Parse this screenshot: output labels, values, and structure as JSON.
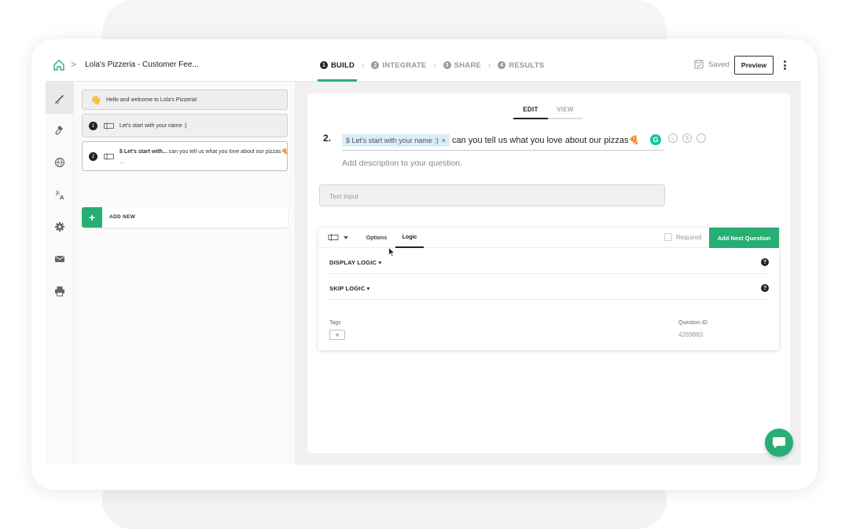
{
  "header": {
    "breadcrumb_sep": ">",
    "project_title": "Lola's Pizzeria - Customer Fee...",
    "steps": [
      {
        "num": "1",
        "label": "BUILD"
      },
      {
        "num": "2",
        "label": "INTEGRATE"
      },
      {
        "num": "3",
        "label": "SHARE"
      },
      {
        "num": "4",
        "label": "RESULTS"
      }
    ],
    "saved_label": "Saved",
    "preview_label": "Preview"
  },
  "left_nav": [
    "brush-icon",
    "paint-roller-icon",
    "globe-icon",
    "translate-icon",
    "gear-icon",
    "mail-icon",
    "printer-icon"
  ],
  "questions": {
    "welcome": {
      "emoji": "👋",
      "text": "Hello and welcome to Lola's Pizzeria!"
    },
    "items": [
      {
        "num": "1",
        "text": "Let's start with your name :)"
      },
      {
        "num": "2",
        "text_bold": "$ Let's start with...",
        "text": " can you tell us what you love about our pizzas🍕",
        "more": "..."
      }
    ],
    "add_new_label": "ADD NEW"
  },
  "editor": {
    "tabs": [
      "EDIT",
      "VIEW"
    ],
    "question_number": "2.",
    "pipe_chip": "$ Let's start with your name :)",
    "pipe_chip_close": "×",
    "question_text": "can you tell us what you love about our pizzas🍕",
    "grammarly": "G",
    "description_placeholder": "Add description to your question.",
    "input_placeholder": "Text Input",
    "settings": {
      "tabs": [
        "Options",
        "Logic"
      ],
      "required_label": "Required",
      "add_next_label": "Add Next Question",
      "display_logic": "DISPLAY LOGIC",
      "skip_logic": "SKIP LOGIC",
      "help": "?",
      "tags_label": "Tags",
      "tag_add": "+",
      "question_id_label": "Question ID",
      "question_id": "4269883"
    }
  },
  "colors": {
    "accent": "#27ae74"
  }
}
